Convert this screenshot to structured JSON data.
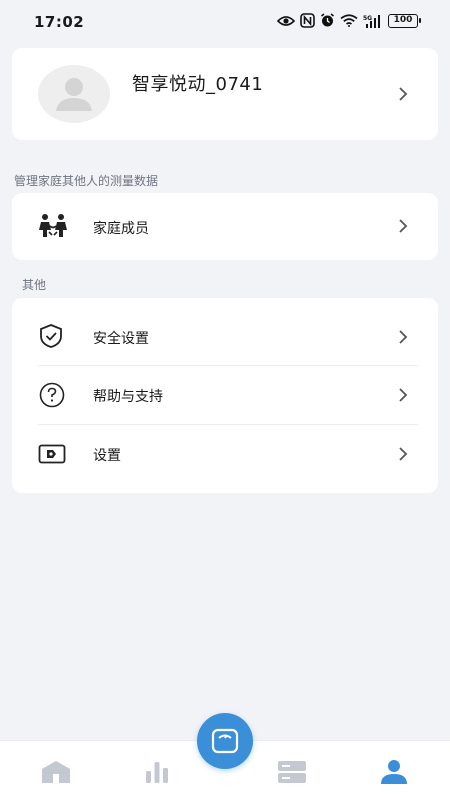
{
  "status_bar": {
    "time": "17:02",
    "battery": "100",
    "network": "5G",
    "icons": [
      "eye-icon",
      "nfc-icon",
      "alarm-icon",
      "wifi-icon",
      "signal-icon",
      "battery-icon"
    ]
  },
  "profile": {
    "name": "智享悦动_0741",
    "avatar_icon": "avatar-placeholder-icon"
  },
  "family_section": {
    "label": "管理家庭其他人的测量数据",
    "item": {
      "label": "家庭成员",
      "icon": "family-icon"
    }
  },
  "other_section": {
    "label": "其他",
    "items": [
      {
        "label": "安全设置",
        "icon": "shield-check-icon"
      },
      {
        "label": "帮助与支持",
        "icon": "help-circle-icon"
      },
      {
        "label": "设置",
        "icon": "settings-icon"
      }
    ]
  },
  "bottom_nav": {
    "items": [
      {
        "icon": "home-icon"
      },
      {
        "icon": "bar-chart-icon"
      },
      {
        "icon": "scale-icon"
      },
      {
        "icon": "devices-icon"
      },
      {
        "icon": "profile-icon"
      }
    ],
    "active_color": "#3b8fd9",
    "inactive_color": "#c4c8d0"
  }
}
